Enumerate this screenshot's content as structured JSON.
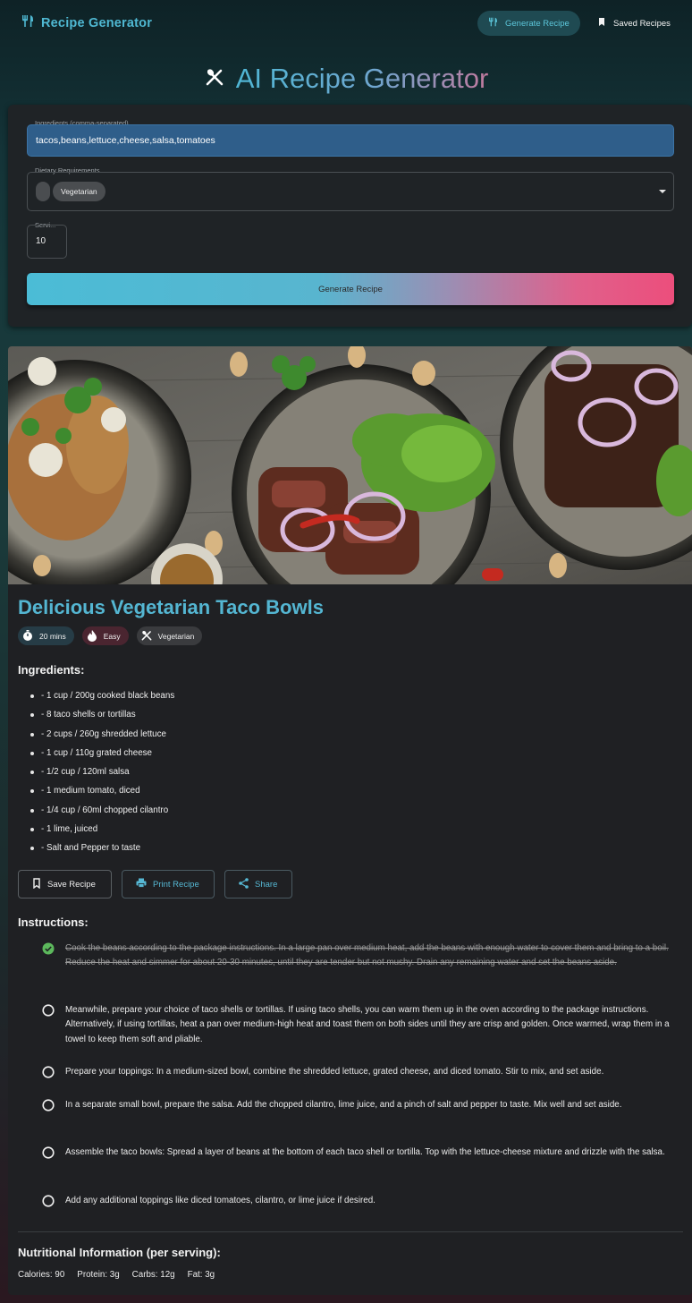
{
  "nav": {
    "brand": "Recipe Generator",
    "generate_label": "Generate Recipe",
    "saved_label": "Saved Recipes"
  },
  "hero": {
    "title": "AI Recipe Generator"
  },
  "form": {
    "ingredients_label": "Ingredients (comma-separated)",
    "ingredients_value": "tacos,beans,lettuce,cheese,salsa,tomatoes",
    "dietary_label": "Dietary Requirements",
    "dietary_selected": [
      "Vegetarian"
    ],
    "servings_label": "Servi...",
    "servings_value": "10",
    "submit_label": "Generate Recipe"
  },
  "recipe": {
    "title": "Delicious Vegetarian Taco Bowls",
    "badges": {
      "time": "20 mins",
      "difficulty": "Easy",
      "diet": "Vegetarian"
    },
    "ingredients_heading": "Ingredients:",
    "ingredients": [
      "- 1 cup / 200g cooked black beans",
      "- 8 taco shells or tortillas",
      "- 2 cups / 260g shredded lettuce",
      "- 1 cup / 110g grated cheese",
      "- 1/2 cup / 120ml salsa",
      "- 1 medium tomato, diced",
      "- 1/4 cup / 60ml chopped cilantro",
      "- 1 lime, juiced",
      "- Salt and Pepper to taste"
    ],
    "actions": {
      "save": "Save Recipe",
      "print": "Print Recipe",
      "share": "Share"
    },
    "instructions_heading": "Instructions:",
    "instructions": [
      {
        "text": "Cook the beans according to the package instructions. In a large pan over medium heat, add the beans with enough water to cover them and bring to a boil. Reduce the heat and simmer for about 20-30 minutes, until they are tender but not mushy. Drain any remaining water and set the beans aside.",
        "done": true
      },
      {
        "text": "Meanwhile, prepare your choice of taco shells or tortillas. If using taco shells, you can warm them up in the oven according to the package instructions. Alternatively, if using tortillas, heat a pan over medium-high heat and toast them on both sides until they are crisp and golden. Once warmed, wrap them in a towel to keep them soft and pliable.",
        "done": false
      },
      {
        "text": "Prepare your toppings: In a medium-sized bowl, combine the shredded lettuce, grated cheese, and diced tomato. Stir to mix, and set aside.",
        "done": false
      },
      {
        "text": "In a separate small bowl, prepare the salsa. Add the chopped cilantro, lime juice, and a pinch of salt and pepper to taste. Mix well and set aside.",
        "done": false
      },
      {
        "text": "Assemble the taco bowls: Spread a layer of beans at the bottom of each taco shell or tortilla. Top with the lettuce-cheese mixture and drizzle with the salsa.",
        "done": false
      },
      {
        "text": "Add any additional toppings like diced tomatoes, cilantro, or lime juice if desired.",
        "done": false
      }
    ],
    "nutrition_heading": "Nutritional Information (per serving):",
    "nutrition": {
      "calories": "Calories: 90",
      "protein": "Protein: 3g",
      "carbs": "Carbs: 12g",
      "fat": "Fat: 3g"
    }
  },
  "colors": {
    "accent": "#54b6d2",
    "input_fill": "#2f5e8a",
    "button_gradient_start": "#4bbcd6",
    "button_gradient_end": "#ec4e7c",
    "check_done": "#5cb85c"
  }
}
